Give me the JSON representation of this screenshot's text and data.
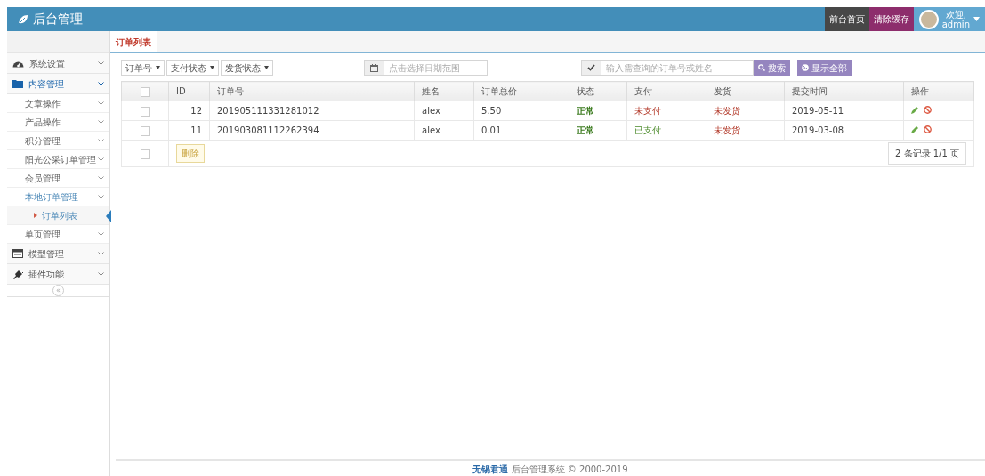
{
  "brand": {
    "title": "后台管理"
  },
  "navbar": {
    "buttons": [
      {
        "label": "前台首页",
        "kind": "dark"
      },
      {
        "label": "清除缓存",
        "kind": "purple"
      }
    ],
    "user": {
      "greeting": "欢迎,",
      "name": "admin"
    }
  },
  "sidebar": {
    "items": [
      {
        "label": "系统设置",
        "expanded": false
      },
      {
        "label": "内容管理",
        "expanded": true,
        "children": [
          {
            "label": "文章操作",
            "expanded": false,
            "selected": false
          },
          {
            "label": "产品操作",
            "expanded": false,
            "selected": false
          },
          {
            "label": "积分管理",
            "expanded": false,
            "selected": false
          },
          {
            "label": "阳光公采订单管理",
            "expanded": false,
            "selected": false
          },
          {
            "label": "会员管理",
            "expanded": false,
            "selected": false
          },
          {
            "label": "本地订单管理",
            "expanded": true,
            "selected": false,
            "children": [
              {
                "label": "订单列表",
                "selected": true
              }
            ]
          },
          {
            "label": "单页管理",
            "expanded": false,
            "selected": false
          }
        ]
      },
      {
        "label": "模型管理",
        "expanded": false
      },
      {
        "label": "插件功能",
        "expanded": false
      }
    ],
    "collapse": "«"
  },
  "tabs": [
    {
      "label": "订单列表",
      "selected": true
    }
  ],
  "toolbar": {
    "filters": [
      {
        "label": "订单号"
      },
      {
        "label": "支付状态"
      },
      {
        "label": "发货状态"
      }
    ],
    "date_range": {
      "placeholder": "点击选择日期范围"
    },
    "search": {
      "placeholder": "输入需查询的订单号或姓名"
    },
    "buttons": [
      {
        "label": "搜索",
        "kind": "search"
      },
      {
        "label": "显示全部",
        "kind": "all"
      }
    ]
  },
  "table": {
    "select_all_checked": false,
    "columns": [
      "ID",
      "订单号",
      "姓名",
      "订单总价",
      "状态",
      "支付",
      "发货",
      "提交时间",
      "操作"
    ],
    "rows": [
      {
        "checked": false,
        "id": "12",
        "order_no": "201905111331281012",
        "name": "alex",
        "total": "5.50",
        "status": {
          "text": "正常",
          "normal": true
        },
        "payment": {
          "text": "未支付",
          "paid": false
        },
        "shipping": {
          "text": "未发货",
          "shipped": false
        },
        "submitted": "2019-05-11"
      },
      {
        "checked": false,
        "id": "11",
        "order_no": "201903081112262394",
        "name": "alex",
        "total": "0.01",
        "status": {
          "text": "正常",
          "normal": true
        },
        "payment": {
          "text": "已支付",
          "paid": true
        },
        "shipping": {
          "text": "未发货",
          "shipped": false
        },
        "submitted": "2019-03-08"
      }
    ],
    "footer_checked": false,
    "delete_button": "删除",
    "pagination": "2 条记录 1/1 页"
  },
  "footer": {
    "link": "无锡君通",
    "text": "后台管理系统 © 2000-2019"
  }
}
